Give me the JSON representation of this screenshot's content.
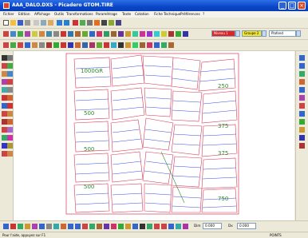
{
  "window": {
    "title": "AAA_DALO.DXS - Picadero GTOM.TIRE"
  },
  "menu": [
    "Fichier",
    "Edition",
    "Affichage",
    "Outils",
    "Transformations",
    "Paramétrage",
    "Texte",
    "Cotation",
    "Fiche Technique",
    "Préférences",
    "?"
  ],
  "toolbar": {
    "combo_red": "Niveau 1",
    "combo_yellow": "Groupe 2",
    "combo_white": "Plafond"
  },
  "canvas": {
    "sizes": [
      "1000GR",
      "250",
      "500",
      "375",
      "500",
      "375",
      "500",
      "750"
    ]
  },
  "bottom": {
    "dim_label": "Dim",
    "dim_value": "0.000",
    "dx_label": "Dx",
    "dx_value": "0.000"
  },
  "status": {
    "message": "Pour l'aide, appuyez sur F1",
    "right": "POINTS"
  },
  "colors": {
    "title_bar": "#0a46c8",
    "pattern_outline": "#d63c5a",
    "seam_line": "#3a4bd6",
    "size_label": "#2e8a2e"
  }
}
